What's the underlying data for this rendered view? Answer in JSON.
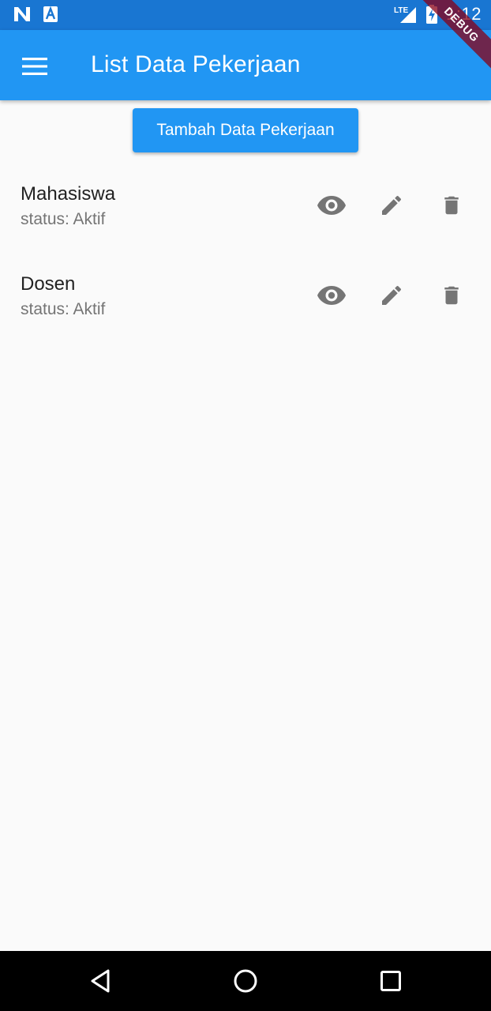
{
  "status_bar": {
    "time": "1:12",
    "network_label": "LTE",
    "notification_icons": [
      "n-icon",
      "a-icon"
    ]
  },
  "app_bar": {
    "title": "List Data Pekerjaan",
    "menu_icon": "menu-icon",
    "debug_label": "DEBUG",
    "color": "#2196f3"
  },
  "add_button": {
    "label": "Tambah Data Pekerjaan"
  },
  "jobs": [
    {
      "name": "Mahasiswa",
      "status": "status: Aktif"
    },
    {
      "name": "Dosen",
      "status": "status: Aktif"
    }
  ],
  "actions": [
    "eye-icon",
    "pencil-icon",
    "trash-icon"
  ],
  "nav_bar": [
    "back-triangle-icon",
    "home-circle-icon",
    "recent-square-icon"
  ],
  "colors": {
    "primary": "#2196f3",
    "status_bar": "#1976d2",
    "icon_grey": "#757575",
    "background": "#fafafa"
  }
}
